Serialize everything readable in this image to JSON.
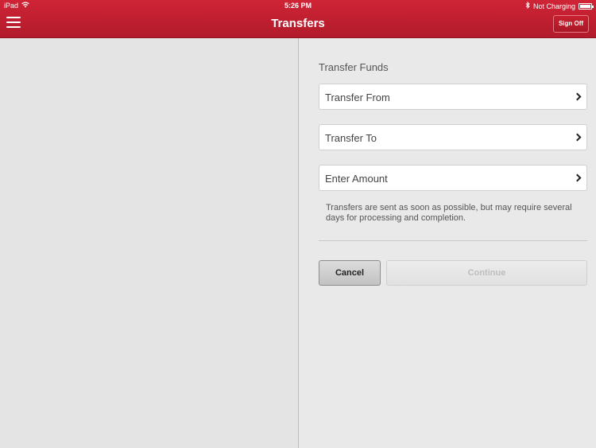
{
  "status_bar": {
    "device": "iPad",
    "time": "5:26 PM",
    "charging": "Not Charging"
  },
  "nav": {
    "title": "Transfers",
    "sign_off_label": "Sign Off",
    "menu_icon": "hamburger-icon"
  },
  "transfer": {
    "section_title": "Transfer Funds",
    "rows": [
      {
        "label": "Transfer From"
      },
      {
        "label": "Transfer To"
      },
      {
        "label": "Enter Amount"
      }
    ],
    "note": "Transfers are sent as soon as possible, but may require several days for processing and completion.",
    "cancel_label": "Cancel",
    "continue_label": "Continue"
  },
  "colors": {
    "brand_red": "#c41f31",
    "panel_bg": "#e9e9e9"
  }
}
